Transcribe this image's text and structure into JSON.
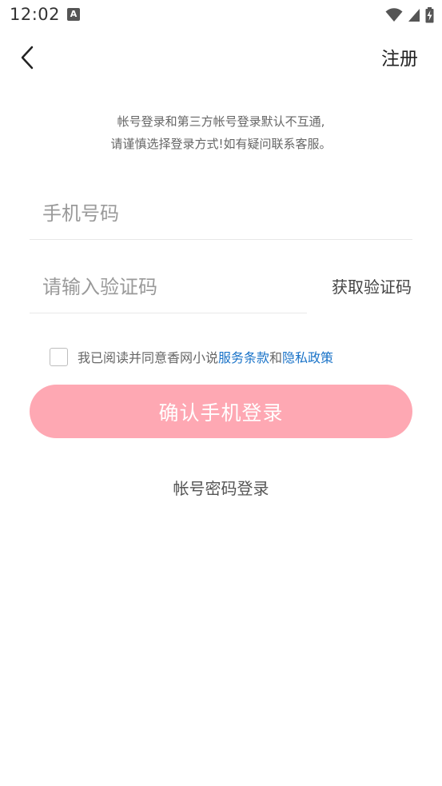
{
  "status_bar": {
    "time": "12:02",
    "notification_icon": "A"
  },
  "nav": {
    "back_icon": "chevron-left-icon",
    "register_label": "注册"
  },
  "notice": {
    "line1": "帐号登录和第三方帐号登录默认不互通,",
    "line2": "请谨慎选择登录方式!如有疑问联系客服。"
  },
  "form": {
    "phone_placeholder": "手机号码",
    "phone_value": "",
    "code_placeholder": "请输入验证码",
    "code_value": "",
    "get_code_label": "获取验证码"
  },
  "agreement": {
    "checked": false,
    "prefix": "我已阅读并同意香网小说",
    "terms_link": "服务条款",
    "and_text": "和",
    "privacy_link": "隐私政策"
  },
  "confirm_label": "确认手机登录",
  "password_login_label": "帐号密码登录",
  "colors": {
    "accent_button": "#fea8b3",
    "link": "#1a73c8"
  }
}
